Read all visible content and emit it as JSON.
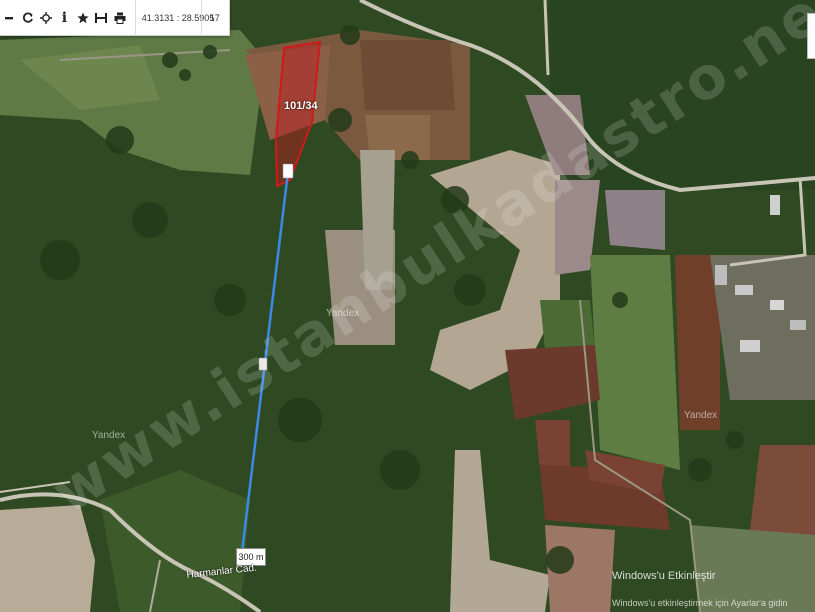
{
  "toolbar": {
    "buttons": [
      {
        "name": "zoom-out",
        "icon": "minus-icon"
      },
      {
        "name": "refresh",
        "icon": "refresh-icon"
      },
      {
        "name": "locate",
        "icon": "crosshair-icon"
      },
      {
        "name": "info",
        "icon": "info-icon"
      },
      {
        "name": "favorite",
        "icon": "star-icon"
      },
      {
        "name": "measure",
        "icon": "ruler-icon"
      },
      {
        "name": "print",
        "icon": "print-icon"
      }
    ],
    "info_glyph": "i",
    "coordinates": "41.3131 : 28.5905",
    "zoom_level": "17"
  },
  "map": {
    "parcel_label": "101/34",
    "distance_label": "300 m",
    "road_label": "Harmanlar Cad.",
    "watermark": "www.istanbulkadastro.net.tr",
    "provider_labels": [
      "Yandex",
      "Yandex",
      "Yandex"
    ],
    "windows_notice": {
      "title": "Windows'u Etkinleştir",
      "subtitle": "Windows'u etkinleştirmek için Ayarlar'a gidin"
    },
    "colors": {
      "parcel_fill": "#c0191d",
      "parcel_stroke": "#d01a1a",
      "measure_line": "#3a8be6",
      "forest": "#2e4a20"
    }
  }
}
